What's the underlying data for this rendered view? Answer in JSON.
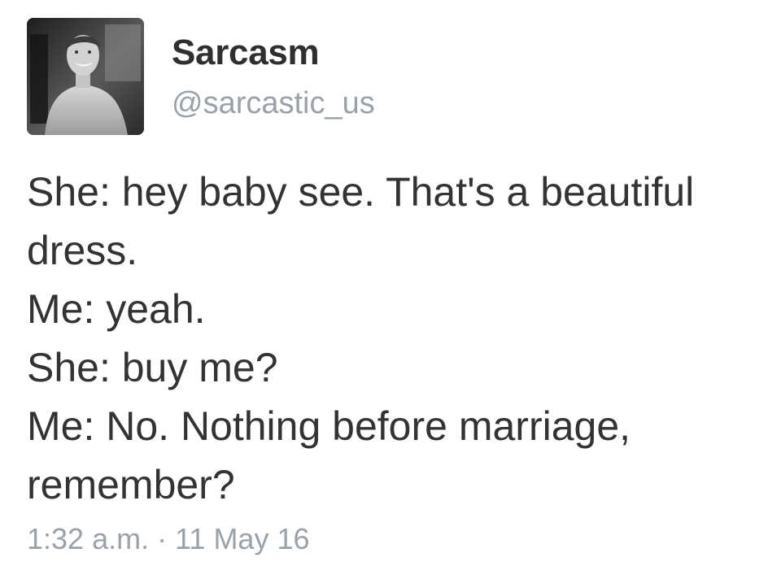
{
  "account": {
    "display_name": "Sarcasm",
    "handle": "@sarcastic_us",
    "avatar": "profile-photo-man-smiling-grayscale"
  },
  "tweet": {
    "lines": [
      "She: hey baby see. That's a beautiful",
      "dress.",
      "Me: yeah.",
      "She: buy me?",
      "Me: No. Nothing before marriage,",
      "remember?"
    ],
    "timestamp": "1:32 a.m. · 11 May 16"
  },
  "colors": {
    "text": "#333333",
    "muted": "#9aa1a8",
    "background": "#ffffff"
  }
}
